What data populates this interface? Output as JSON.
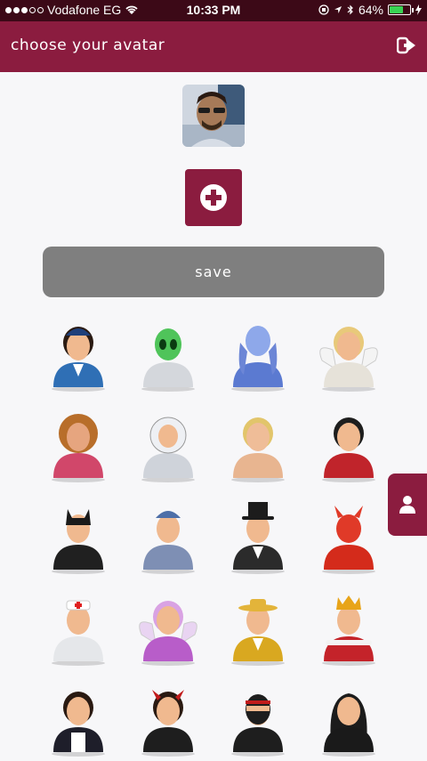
{
  "status_bar": {
    "carrier": "Vodafone EG",
    "time": "10:33 PM",
    "battery_percent": "64%",
    "battery_level": 0.64,
    "signal_bars": 3
  },
  "header": {
    "title": "choose your avatar",
    "logout_icon": "logout-icon"
  },
  "profile_photo": {
    "icon": "user-photo"
  },
  "add_button": {
    "icon": "plus-circle-icon"
  },
  "save_button": {
    "label": "save"
  },
  "side_tab": {
    "icon": "user-icon"
  },
  "colors": {
    "primary": "#8b1c3f",
    "status_bar": "#3c0917",
    "save_bg": "#7f7f7f",
    "background": "#f7f7f9"
  },
  "avatars": [
    "flight-attendant",
    "alien",
    "blue-alien",
    "angel",
    "long-hair-woman",
    "astronaut",
    "blonde-woman",
    "dark-hair-woman",
    "catwoman",
    "worker",
    "magician",
    "devil",
    "nurse",
    "fairy",
    "detective",
    "king",
    "maid",
    "devil-girl",
    "ninja",
    "nun"
  ]
}
